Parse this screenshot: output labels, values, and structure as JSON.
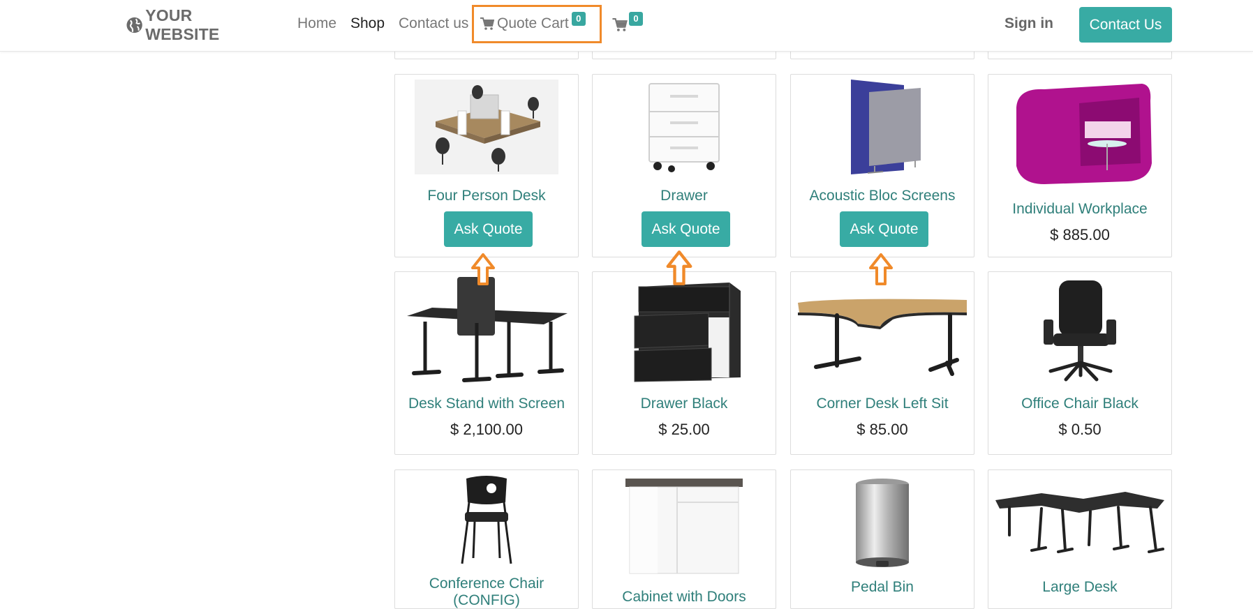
{
  "navbar": {
    "brand": "YOUR WEBSITE",
    "links": [
      "Home",
      "Shop",
      "Contact us"
    ],
    "quote_cart_label": "Quote Cart",
    "quote_cart_count": "0",
    "cart_count": "0",
    "sign_in": "Sign in",
    "contact_us": "Contact Us"
  },
  "colors": {
    "accent": "#38aba4",
    "highlight": "#f08a2a",
    "product_name": "#2f7f7a"
  },
  "ask_quote_label": "Ask Quote",
  "row1": [
    {
      "name": "Four Person Desk"
    },
    {
      "name": "Drawer"
    },
    {
      "name": "Acoustic Bloc Screens"
    },
    {
      "name": "Individual Workplace",
      "price": "$ 885.00"
    }
  ],
  "row2": [
    {
      "name": "Desk Stand with Screen",
      "price": "$ 2,100.00"
    },
    {
      "name": "Drawer Black",
      "price": "$ 25.00"
    },
    {
      "name": "Corner Desk Left Sit",
      "price": "$ 85.00"
    },
    {
      "name": "Office Chair Black",
      "price": "$ 0.50"
    }
  ],
  "row3": [
    {
      "name": "Conference Chair (CONFIG)"
    },
    {
      "name": "Cabinet with Doors"
    },
    {
      "name": "Pedal Bin"
    },
    {
      "name": "Large Desk"
    }
  ]
}
